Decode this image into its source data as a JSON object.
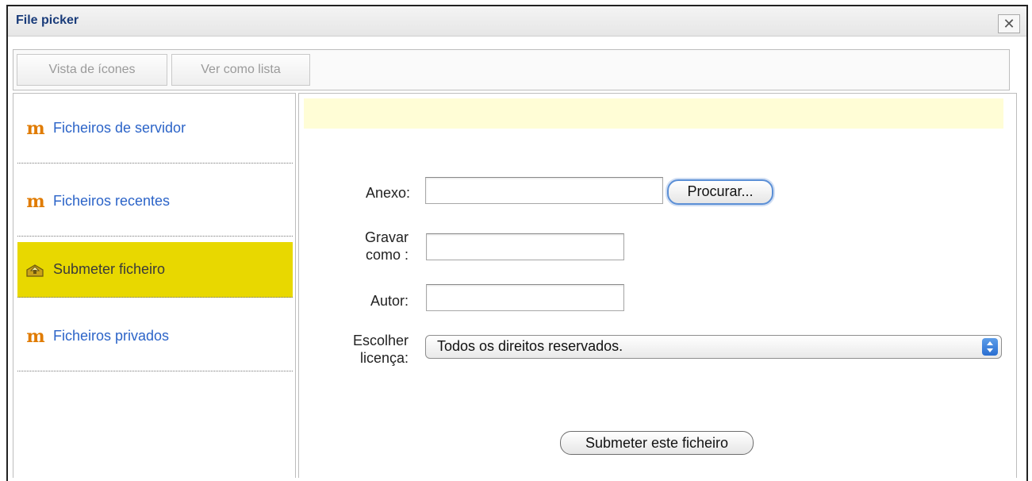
{
  "window": {
    "title": "File picker",
    "close_symbol": "✕"
  },
  "toolbar": {
    "icon_view_label": "Vista de ícones",
    "list_view_label": "Ver como lista"
  },
  "sidebar": {
    "items": [
      {
        "label": "Ficheiros de servidor",
        "icon": "moodle-icon",
        "active": false
      },
      {
        "label": "Ficheiros recentes",
        "icon": "moodle-icon",
        "active": false
      },
      {
        "label": "Submeter ficheiro",
        "icon": "upload-icon",
        "active": true
      },
      {
        "label": "Ficheiros privados",
        "icon": "moodle-icon",
        "active": false
      }
    ],
    "active_color": "#e8d800",
    "link_color": "#2c64c8"
  },
  "form": {
    "attachment_label": "Anexo:",
    "attachment_value": "",
    "browse_label": "Procurar...",
    "saveas_label_line1": "Gravar",
    "saveas_label_line2": "como :",
    "saveas_value": "",
    "author_label": "Autor:",
    "author_value": "",
    "license_label_line1": "Escolher",
    "license_label_line2": "licença:",
    "license_selected": "Todos os direitos reservados.",
    "submit_label": "Submeter este ficheiro"
  },
  "message_bar_color": "#fffdd6"
}
